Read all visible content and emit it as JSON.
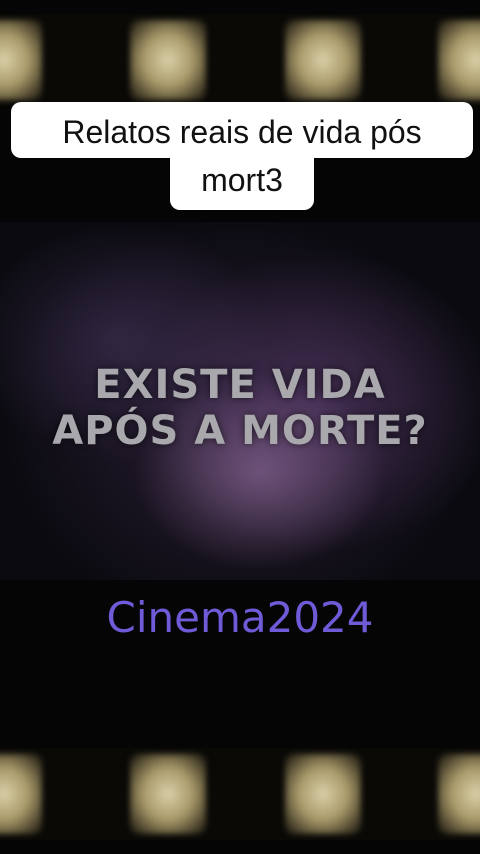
{
  "caption": {
    "line1": "Relatos reais de vida pós",
    "line2": "mort3"
  },
  "video": {
    "title_line1": "EXISTE VIDA",
    "title_line2": "APÓS A MORTE?"
  },
  "watermark": "Cinema2024",
  "colors": {
    "watermark": "#6f5bd8",
    "caption_bg": "#ffffff",
    "title_text": "#a9a9ad"
  }
}
